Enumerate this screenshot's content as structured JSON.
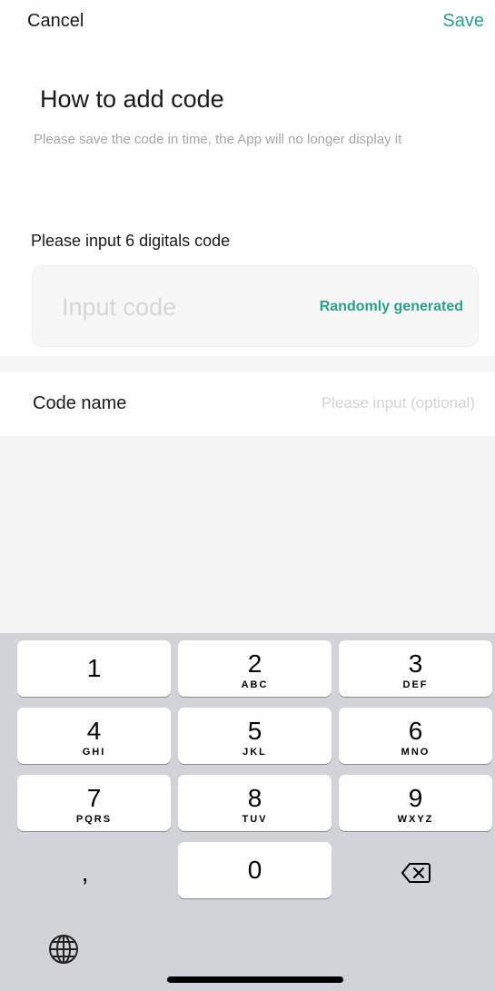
{
  "nav": {
    "cancel_label": "Cancel",
    "save_label": "Save"
  },
  "header": {
    "title": "How to add code",
    "subtitle": "Please save the code in time, the App will no longer display it"
  },
  "code_field": {
    "label": "Please input 6 digitals code",
    "placeholder": "Input code",
    "value": "",
    "random_label": "Randomly generated"
  },
  "name_field": {
    "label": "Code name",
    "placeholder": "Please input (optional)",
    "value": ""
  },
  "keypad": {
    "keys": [
      {
        "num": "1",
        "letters": ""
      },
      {
        "num": "2",
        "letters": "ABC"
      },
      {
        "num": "3",
        "letters": "DEF"
      },
      {
        "num": "4",
        "letters": "GHI"
      },
      {
        "num": "5",
        "letters": "JKL"
      },
      {
        "num": "6",
        "letters": "MNO"
      },
      {
        "num": "7",
        "letters": "PQRS"
      },
      {
        "num": "8",
        "letters": "TUV"
      },
      {
        "num": "9",
        "letters": "WXYZ"
      },
      {
        "num": "0",
        "letters": ""
      }
    ],
    "comma_label": ",",
    "delete_icon": "backspace-icon",
    "globe_icon": "globe-icon"
  },
  "colors": {
    "accent": "#2aa18a",
    "keyboard_bg": "#d1d3d9",
    "muted_text": "#a6a6a6"
  }
}
